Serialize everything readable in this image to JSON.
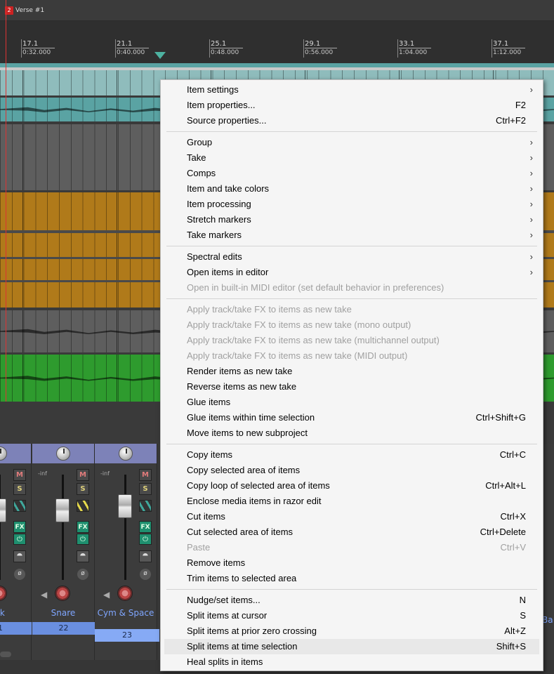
{
  "region": {
    "number": "2",
    "name": "Verse #1"
  },
  "ruler": {
    "marks": [
      {
        "bar": "17.1",
        "time": "0:32.000"
      },
      {
        "bar": "21.1",
        "time": "0:40.000"
      },
      {
        "bar": "25.1",
        "time": "0:48.000"
      },
      {
        "bar": "29.1",
        "time": "0:56.000"
      },
      {
        "bar": "33.1",
        "time": "1:04.000"
      },
      {
        "bar": "37.1",
        "time": "1:12.000"
      }
    ]
  },
  "mixer": {
    "inf_label": "-inf",
    "btn_m": "M",
    "btn_s": "S",
    "btn_fx": "FX",
    "power_glyph": "⏻",
    "route_glyph": "⯊",
    "phase_glyph": "ø",
    "speaker_glyph": "◀",
    "strips": [
      {
        "name": "ck",
        "number": "1"
      },
      {
        "name": "Snare",
        "number": "22"
      },
      {
        "name": "Cym & Space",
        "number": "23"
      }
    ],
    "partial_right_name": "Ba"
  },
  "context_menu": {
    "submenu_arrow": "›",
    "groups": [
      [
        {
          "label": "Item settings",
          "submenu": true
        },
        {
          "label": "Item properties...",
          "shortcut": "F2"
        },
        {
          "label": "Source properties...",
          "shortcut": "Ctrl+F2"
        }
      ],
      [
        {
          "label": "Group",
          "submenu": true
        },
        {
          "label": "Take",
          "submenu": true
        },
        {
          "label": "Comps",
          "submenu": true
        },
        {
          "label": "Item and take colors",
          "submenu": true
        },
        {
          "label": "Item processing",
          "submenu": true
        },
        {
          "label": "Stretch markers",
          "submenu": true
        },
        {
          "label": "Take markers",
          "submenu": true
        }
      ],
      [
        {
          "label": "Spectral edits",
          "submenu": true
        },
        {
          "label": "Open items in editor",
          "submenu": true
        },
        {
          "label": "Open in built-in MIDI editor (set default behavior in preferences)",
          "disabled": true
        }
      ],
      [
        {
          "label": "Apply track/take FX to items as new take",
          "disabled": true
        },
        {
          "label": "Apply track/take FX to items as new take (mono output)",
          "disabled": true
        },
        {
          "label": "Apply track/take FX to items as new take (multichannel output)",
          "disabled": true
        },
        {
          "label": "Apply track/take FX to items as new take (MIDI output)",
          "disabled": true
        },
        {
          "label": "Render items as new take"
        },
        {
          "label": "Reverse items as new take"
        },
        {
          "label": "Glue items"
        },
        {
          "label": "Glue items within time selection",
          "shortcut": "Ctrl+Shift+G"
        },
        {
          "label": "Move items to new subproject"
        }
      ],
      [
        {
          "label": "Copy items",
          "shortcut": "Ctrl+C"
        },
        {
          "label": "Copy selected area of items"
        },
        {
          "label": "Copy loop of selected area of items",
          "shortcut": "Ctrl+Alt+L"
        },
        {
          "label": "Enclose media items in razor edit"
        },
        {
          "label": "Cut items",
          "shortcut": "Ctrl+X"
        },
        {
          "label": "Cut selected area of items",
          "shortcut": "Ctrl+Delete"
        },
        {
          "label": "Paste",
          "shortcut": "Ctrl+V",
          "disabled": true
        },
        {
          "label": "Remove items"
        },
        {
          "label": "Trim items to selected area"
        }
      ],
      [
        {
          "label": "Nudge/set items...",
          "shortcut": "N"
        },
        {
          "label": "Split items at cursor",
          "shortcut": "S"
        },
        {
          "label": "Split items at prior zero crossing",
          "shortcut": "Alt+Z"
        },
        {
          "label": "Split items at time selection",
          "shortcut": "Shift+S",
          "hover": true
        },
        {
          "label": "Heal splits in items"
        }
      ]
    ]
  },
  "colors": {
    "teal_item": "#8fbcbc",
    "teal_dark": "#5aa3a3",
    "gray_item": "#5e5e5e",
    "orange_item": "#b07a1a",
    "green_item": "#2e9b2e",
    "playhead": "#4db2a1",
    "edit_cursor": "#dd3333",
    "mixer_header": "#7d82b8"
  }
}
